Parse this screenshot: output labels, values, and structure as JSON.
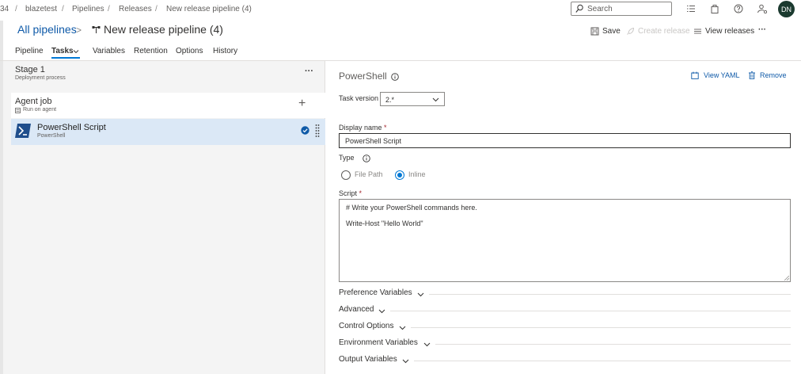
{
  "breadcrumb": {
    "org_fragment": "34",
    "project": "blazetest",
    "pipelines": "Pipelines",
    "releases": "Releases",
    "current": "New release pipeline (4)",
    "separator": "/"
  },
  "topbar": {
    "search_placeholder": "Search",
    "icons": [
      "search-icon",
      "list-icon",
      "bag-icon",
      "help-icon",
      "user-settings-icon"
    ],
    "avatar_initials": "DN",
    "avatar_color": "#1b3a2f"
  },
  "header": {
    "all_pipelines": "All pipelines",
    "chevron": ">",
    "title": "New release pipeline (4)",
    "actions": {
      "save": "Save",
      "create_release": "Create release",
      "view_releases": "View releases",
      "more": "···"
    }
  },
  "tabs": [
    {
      "label": "Pipeline"
    },
    {
      "label": "Tasks"
    },
    {
      "label": "Variables"
    },
    {
      "label": "Retention"
    },
    {
      "label": "Options"
    },
    {
      "label": "History"
    }
  ],
  "active_tab": "Tasks",
  "stage": {
    "name": "Stage 1",
    "subtitle": "Deployment process",
    "more": "···"
  },
  "agent_job": {
    "name": "Agent job",
    "subtitle": "Run on agent",
    "add": "+"
  },
  "task": {
    "name": "PowerShell Script",
    "subtitle": "PowerShell",
    "selected_color": "#dbe8f6"
  },
  "details": {
    "title": "PowerShell",
    "view_yaml": "View YAML",
    "remove": "Remove",
    "task_version_label": "Task version",
    "task_version": "2.*",
    "display_name_label": "Display name",
    "display_name": "PowerShell Script",
    "required_mark": "*",
    "type_label": "Type",
    "type_options": [
      "File Path",
      "Inline"
    ],
    "type_selected": "Inline",
    "script_label": "Script",
    "script_lines": [
      "# Write your PowerShell commands here.",
      "Write-Host \"Hello World\""
    ],
    "sections": [
      "Preference Variables",
      "Advanced",
      "Control Options",
      "Environment Variables",
      "Output Variables"
    ]
  },
  "colors": {
    "link": "#0f5aa8",
    "accent": "#0078d4",
    "left_panel_bg": "#f4f4f4"
  }
}
